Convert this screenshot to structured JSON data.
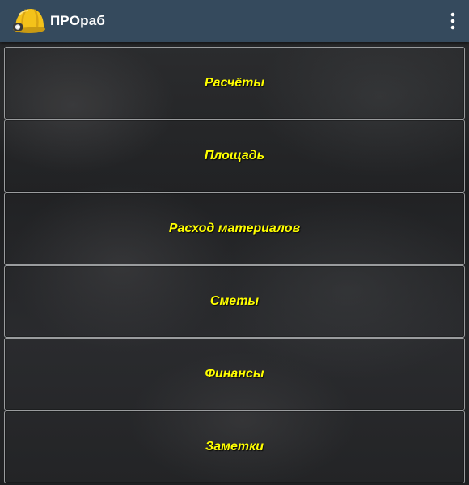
{
  "app": {
    "title": "ПРОраб",
    "logo_icon": "hard-hat-icon",
    "overflow_icon": "more-vert-icon"
  },
  "colors": {
    "toolbar": "#354a5d",
    "label": "#ffff00",
    "border": "#9a9c9e"
  },
  "menu": {
    "items": [
      {
        "label": "Расчёты"
      },
      {
        "label": "Площадь"
      },
      {
        "label": "Расход материалов"
      },
      {
        "label": "Сметы"
      },
      {
        "label": "Финансы"
      },
      {
        "label": "Заметки"
      }
    ]
  }
}
